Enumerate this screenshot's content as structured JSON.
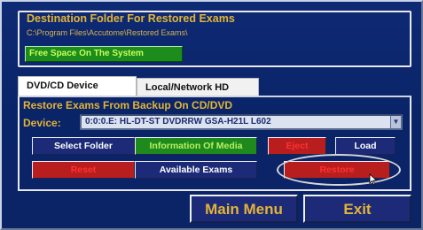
{
  "destination": {
    "title": "Destination Folder For Restored Exams",
    "path": "C:\\Program Files\\Accutome\\Restored Exams\\",
    "free_space_label": "Free Space On The System"
  },
  "tabs": [
    {
      "label": "DVD/CD Device",
      "selected": true
    },
    {
      "label": "Local/Network HD",
      "selected": false
    }
  ],
  "restore_panel": {
    "title": "Restore Exams From Backup On CD/DVD",
    "device_label": "Device:",
    "device_value": "0:0:0.E: HL-DT-ST DVDRRW GSA-H21L  L602",
    "buttons": {
      "select_folder": "Select Folder",
      "information_of_media": "Information Of Media",
      "eject": "Eject",
      "load": "Load",
      "reset": "Reset",
      "available_exams": "Available Exams",
      "restore": "Restore"
    }
  },
  "footer": {
    "main_menu": "Main Menu",
    "exit": "Exit"
  },
  "colors": {
    "background": "#0b2466",
    "title_gold": "#e2b437",
    "green_button": "#1e8a1e",
    "red_button": "#b81e1e",
    "navy_button": "#1c2a78"
  }
}
